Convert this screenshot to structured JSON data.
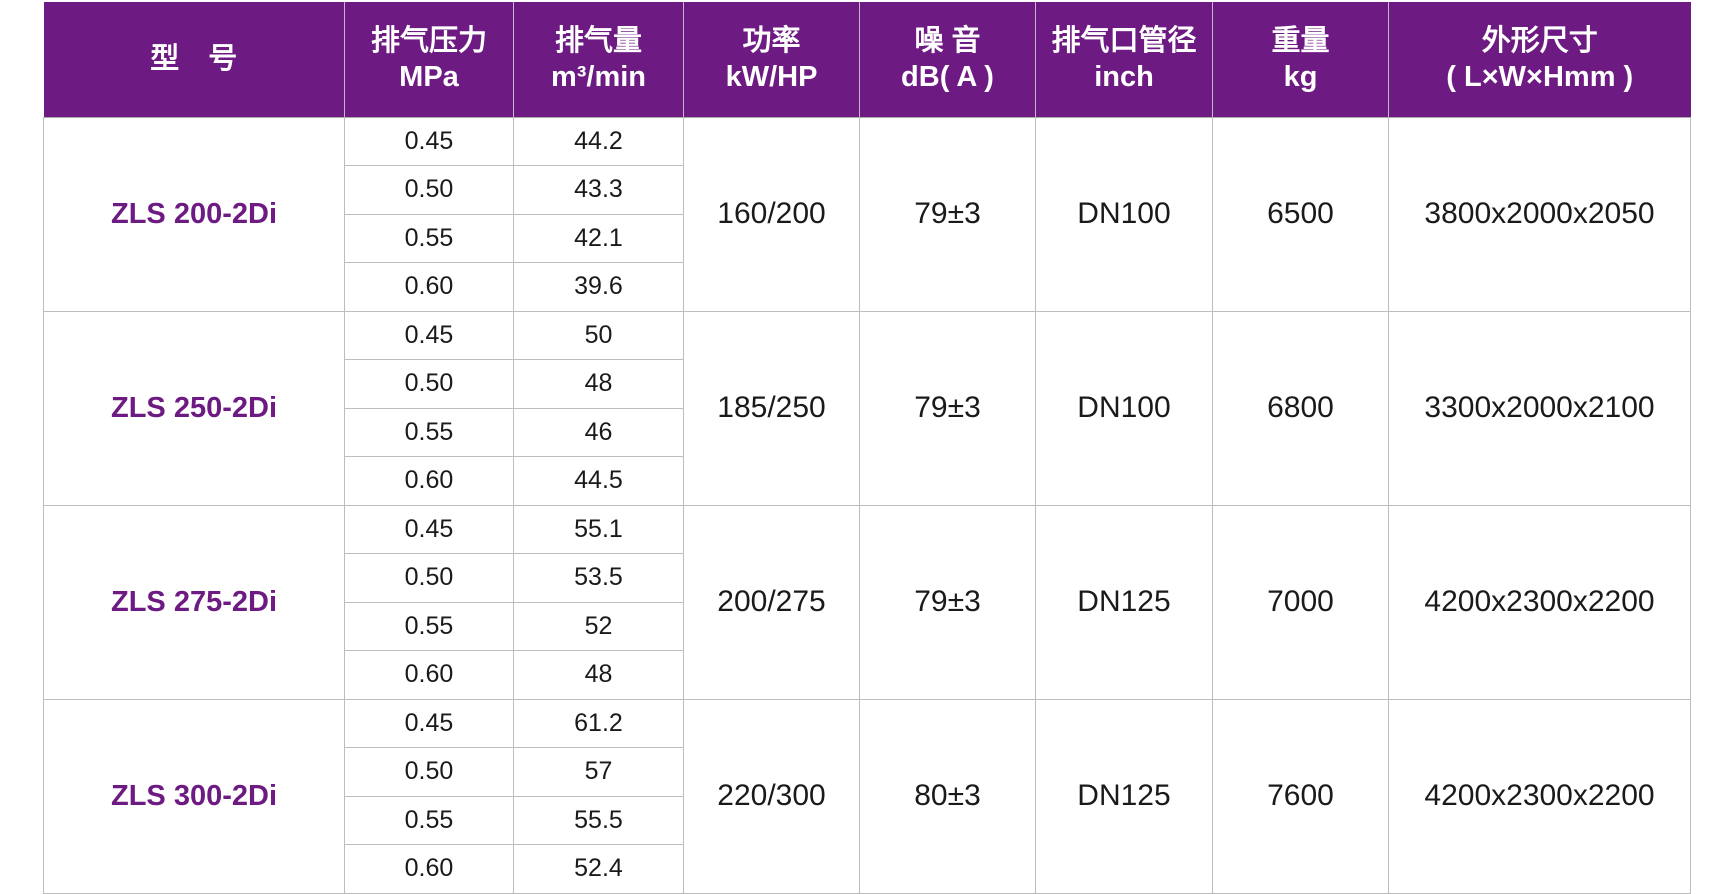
{
  "table": {
    "headers": [
      {
        "l1": "型　号",
        "l2": ""
      },
      {
        "l1": "排气压力",
        "l2": "MPa"
      },
      {
        "l1": "排气量",
        "l2": "m³/min"
      },
      {
        "l1": "功率",
        "l2": "kW/HP"
      },
      {
        "l1": "噪 音",
        "l2": "dB( A )"
      },
      {
        "l1": "排气口管径",
        "l2": "inch"
      },
      {
        "l1": "重量",
        "l2": "kg"
      },
      {
        "l1": "外形尺寸",
        "l2": "( L×W×Hmm )"
      }
    ],
    "groups": [
      {
        "model": "ZLS 200-2Di",
        "power": "160/200",
        "noise": "79±3",
        "outlet": "DN100",
        "weight": "6500",
        "dims": "3800x2000x2050",
        "rows": [
          {
            "pressure": "0.45",
            "flow": "44.2"
          },
          {
            "pressure": "0.50",
            "flow": "43.3"
          },
          {
            "pressure": "0.55",
            "flow": "42.1"
          },
          {
            "pressure": "0.60",
            "flow": "39.6"
          }
        ]
      },
      {
        "model": "ZLS 250-2Di",
        "power": "185/250",
        "noise": "79±3",
        "outlet": "DN100",
        "weight": "6800",
        "dims": "3300x2000x2100",
        "rows": [
          {
            "pressure": "0.45",
            "flow": "50"
          },
          {
            "pressure": "0.50",
            "flow": "48"
          },
          {
            "pressure": "0.55",
            "flow": "46"
          },
          {
            "pressure": "0.60",
            "flow": "44.5"
          }
        ]
      },
      {
        "model": "ZLS 275-2Di",
        "power": "200/275",
        "noise": "79±3",
        "outlet": "DN125",
        "weight": "7000",
        "dims": "4200x2300x2200",
        "rows": [
          {
            "pressure": "0.45",
            "flow": "55.1"
          },
          {
            "pressure": "0.50",
            "flow": "53.5"
          },
          {
            "pressure": "0.55",
            "flow": "52"
          },
          {
            "pressure": "0.60",
            "flow": "48"
          }
        ]
      },
      {
        "model": "ZLS 300-2Di",
        "power": "220/300",
        "noise": "80±3",
        "outlet": "DN125",
        "weight": "7600",
        "dims": "4200x2300x2200",
        "rows": [
          {
            "pressure": "0.45",
            "flow": "61.2"
          },
          {
            "pressure": "0.50",
            "flow": "57"
          },
          {
            "pressure": "0.55",
            "flow": "55.5"
          },
          {
            "pressure": "0.60",
            "flow": "52.4"
          }
        ]
      }
    ]
  }
}
